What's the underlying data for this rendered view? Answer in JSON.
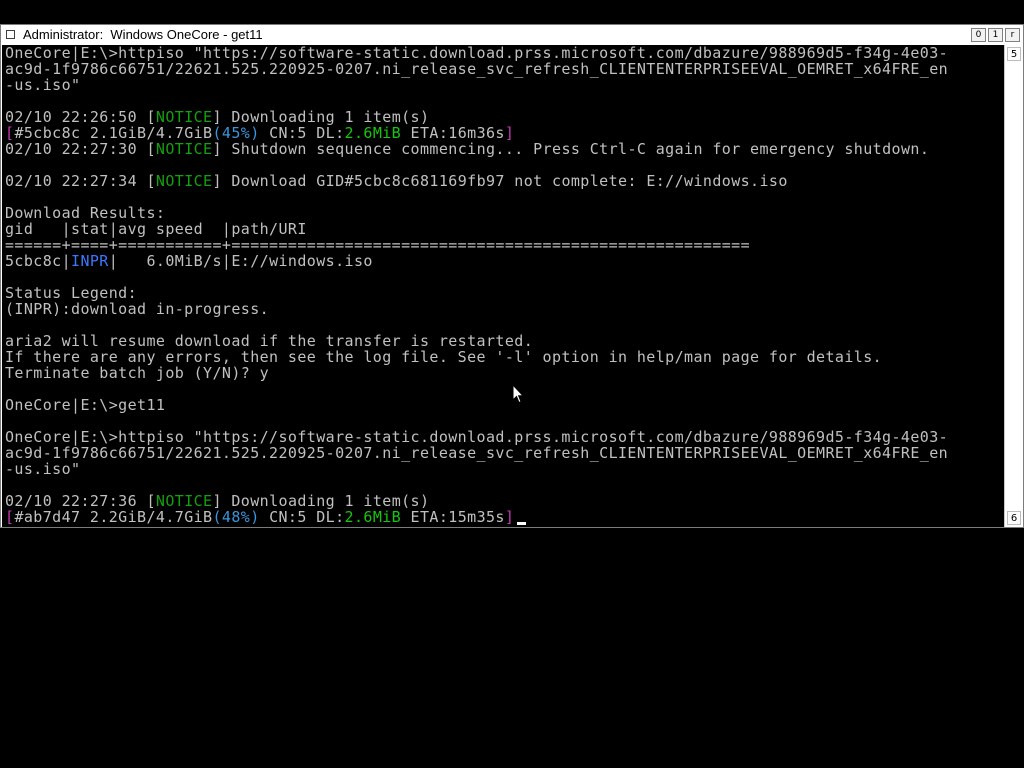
{
  "window": {
    "title": "Administrator:  Windows OneCore - get11",
    "buttons": {
      "minimize": "0",
      "maximize": "1",
      "close": "r"
    }
  },
  "scrollbar": {
    "up_glyph": "5",
    "down_glyph": "6"
  },
  "colors": {
    "notice": "#13a10e",
    "magenta": "#c239b3",
    "cyan": "#3a96dd",
    "green": "#16c60c",
    "blue": "#3b78ff",
    "text": "#c0c0c0"
  },
  "console": {
    "cmd1_line1": "OneCore|E:\\>httpiso \"https://software-static.download.prss.microsoft.com/dbazure/988969d5-f34g-4e03-",
    "cmd1_line2": "ac9d-1f9786c66751/22621.525.220925-0207.ni_release_svc_refresh_CLIENTENTERPRISEEVAL_OEMRET_x64FRE_en",
    "cmd1_line3": "-us.iso\"",
    "dl1": {
      "timestamp": "02/10 22:26:50 ",
      "bracket_open": "[",
      "tag": "NOTICE",
      "bracket_close": "]",
      "message": " Downloading 1 item(s)"
    },
    "progress1": {
      "open": "[",
      "gid": "#5cbc8c",
      "size": " 2.1GiB/4.7GiB",
      "percent": "(45%)",
      "cn": " CN:5 DL:",
      "speed": "2.6MiB",
      "eta_label": " ETA:",
      "eta": "16m36s",
      "close": "]"
    },
    "shutdown": {
      "timestamp": "02/10 22:27:30 ",
      "bracket_open": "[",
      "tag": "NOTICE",
      "bracket_close": "]",
      "message": " Shutdown sequence commencing... Press Ctrl-C again for emergency shutdown."
    },
    "not_complete": {
      "timestamp": "02/10 22:27:34 ",
      "bracket_open": "[",
      "tag": "NOTICE",
      "bracket_close": "]",
      "message": " Download GID#5cbc8c681169fb97 not complete: E://windows.iso"
    },
    "results_title": "Download Results:",
    "results_header": "gid   |stat|avg speed  |path/URI",
    "results_rule": "======+====+===========+=======================================================",
    "results_row": {
      "gid": "5cbc8c|",
      "stat": "INPR",
      "rest": "|   6.0MiB/s|E://windows.iso"
    },
    "legend_title": "Status Legend:",
    "legend_inpr": "(INPR):download in-progress.",
    "resume_note": "aria2 will resume download if the transfer is restarted.",
    "errors_note": "If there are any errors, then see the log file. See '-l' option in help/man page for details.",
    "terminate": "Terminate batch job (Y/N)? y",
    "prompt_get11": "OneCore|E:\\>get11",
    "cmd2_line1": "OneCore|E:\\>httpiso \"https://software-static.download.prss.microsoft.com/dbazure/988969d5-f34g-4e03-",
    "cmd2_line2": "ac9d-1f9786c66751/22621.525.220925-0207.ni_release_svc_refresh_CLIENTENTERPRISEEVAL_OEMRET_x64FRE_en",
    "cmd2_line3": "-us.iso\"",
    "dl2": {
      "timestamp": "02/10 22:27:36 ",
      "bracket_open": "[",
      "tag": "NOTICE",
      "bracket_close": "]",
      "message": " Downloading 1 item(s)"
    },
    "progress2": {
      "open": "[",
      "gid": "#ab7d47",
      "size": " 2.2GiB/4.7GiB",
      "percent": "(48%)",
      "cn": " CN:5 DL:",
      "speed": "2.6MiB",
      "eta_label": " ETA:",
      "eta": "15m35s",
      "close": "]"
    }
  }
}
